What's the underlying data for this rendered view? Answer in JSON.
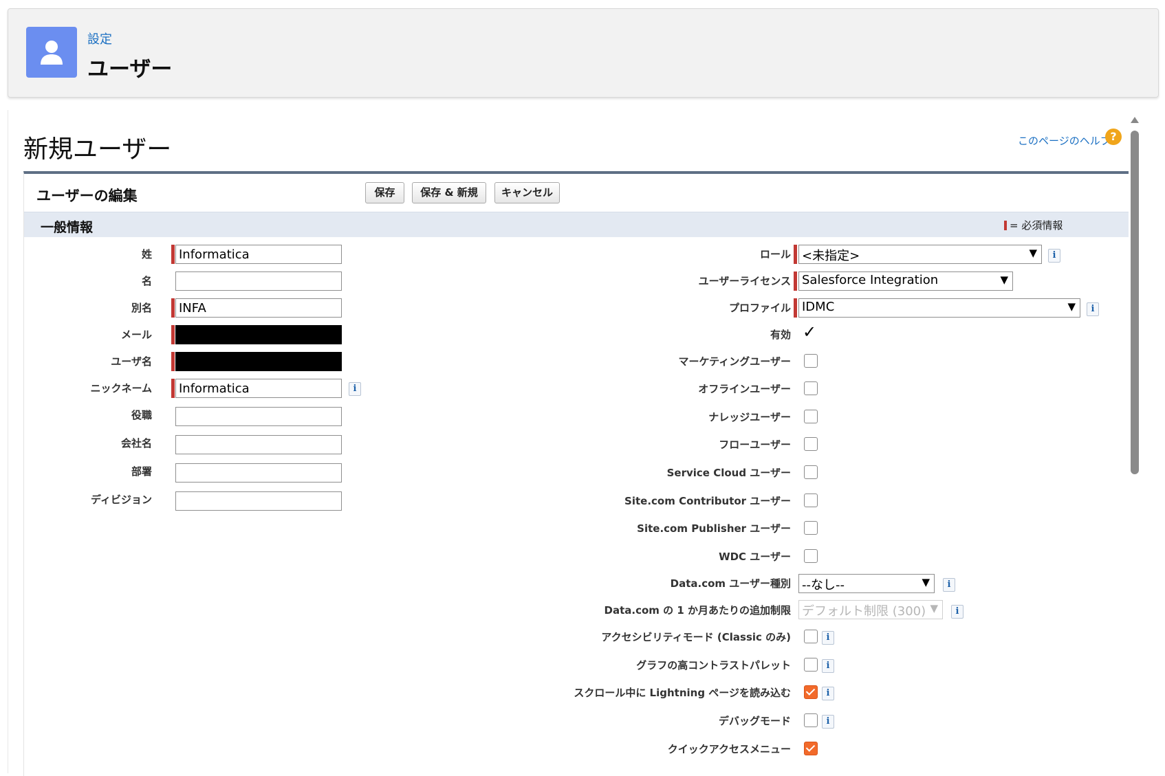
{
  "header": {
    "breadcrumb": "設定",
    "title": "ユーザー",
    "icon": "user-icon",
    "icon_color": "#6b8ef0"
  },
  "page": {
    "title": "新規ユーザー",
    "help_link": "このページのヘルプ",
    "help_icon": "?"
  },
  "edit": {
    "title": "ユーザーの編集",
    "buttons": {
      "save": "保存",
      "save_new": "保存 & 新規",
      "cancel": "キャンセル"
    }
  },
  "section": {
    "title": "一般情報",
    "required_note": "= 必須情報",
    "required_color": "#c23934"
  },
  "left_fields": [
    {
      "label": "姓",
      "value": "Informatica"
    },
    {
      "label": "名",
      "value": ""
    },
    {
      "label": "別名",
      "value": "INFA"
    },
    {
      "label": "メール",
      "value": ""
    },
    {
      "label": "ユーザ名",
      "value": ""
    },
    {
      "label": "ニックネーム",
      "value": "Informatica"
    },
    {
      "label": "役職",
      "value": ""
    },
    {
      "label": "会社名",
      "value": ""
    },
    {
      "label": "部署",
      "value": ""
    },
    {
      "label": "ディビジョン",
      "value": ""
    }
  ],
  "right_fields": {
    "role": {
      "label": "ロール",
      "value": "<未指定>"
    },
    "license": {
      "label": "ユーザーライセンス",
      "value": "Salesforce Integration"
    },
    "profile": {
      "label": "プロファイル",
      "value": "IDMC"
    },
    "active": {
      "label": "有効",
      "value": "✓"
    },
    "checkboxes": [
      {
        "label": "マーケティングユーザー",
        "checked": false
      },
      {
        "label": "オフラインユーザー",
        "checked": false
      },
      {
        "label": "ナレッジユーザー",
        "checked": false
      },
      {
        "label": "フローユーザー",
        "checked": false
      },
      {
        "label": "Service Cloud ユーザー",
        "checked": false
      },
      {
        "label": "Site.com Contributor ユーザー",
        "checked": false
      },
      {
        "label": "Site.com Publisher ユーザー",
        "checked": false
      },
      {
        "label": "WDC ユーザー",
        "checked": false
      }
    ],
    "datacom_type": {
      "label": "Data.com ユーザー種別",
      "value": "--なし--"
    },
    "datacom_limit": {
      "label": "Data.com の 1 か月あたりの追加制限",
      "value": "デフォルト制限 (300)"
    },
    "options": [
      {
        "label": "アクセシビリティモード (Classic のみ)",
        "checked": false
      },
      {
        "label": "グラフの高コントラストパレット",
        "checked": false
      },
      {
        "label": "スクロール中に Lightning ページを読み込む",
        "checked": true
      },
      {
        "label": "デバッグモード",
        "checked": false
      },
      {
        "label": "クイックアクセスメニュー",
        "checked": true
      }
    ],
    "checked_color": "#f26a2a"
  }
}
